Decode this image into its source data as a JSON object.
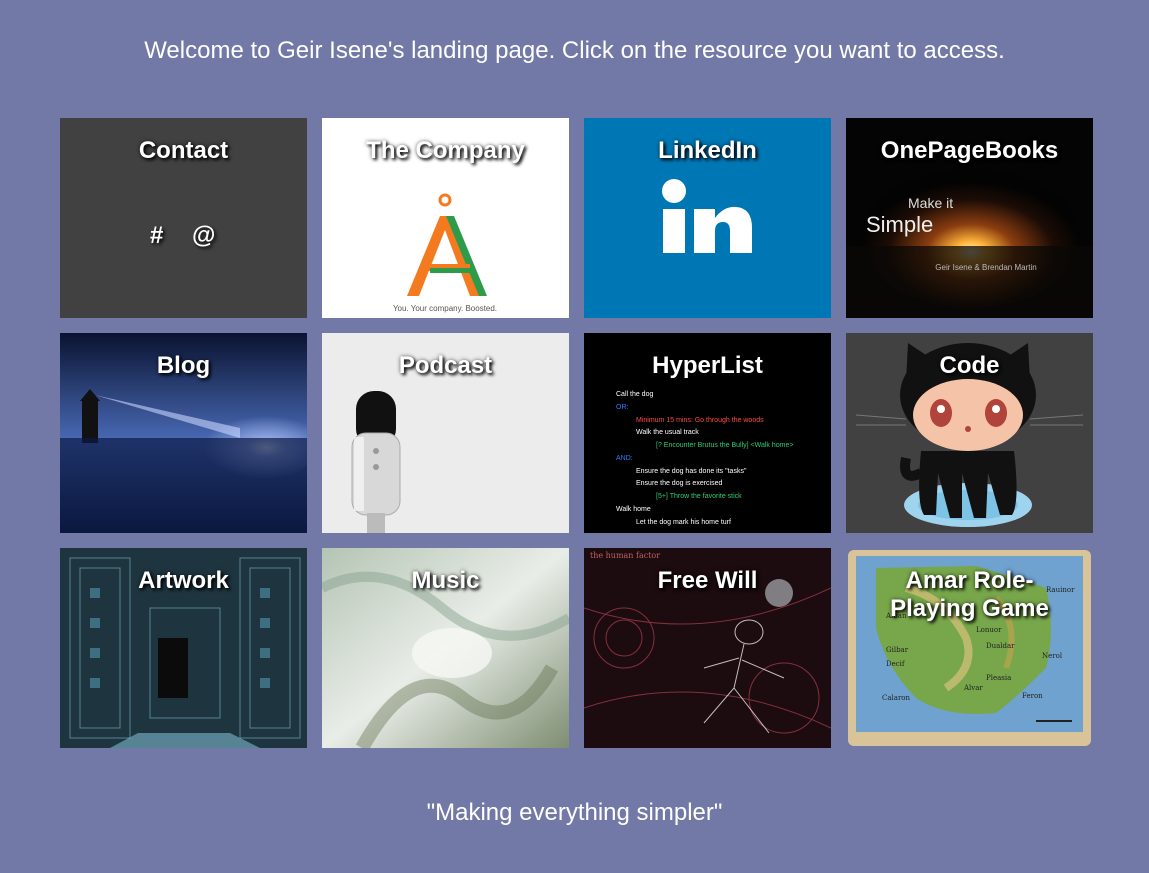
{
  "intro": "Welcome to Geir Isene's landing page. Click on the resource you want to access.",
  "tiles": [
    {
      "title": "Contact",
      "symbols": [
        "#",
        "@"
      ]
    },
    {
      "title": "The Company",
      "logo_letter": "Å",
      "tagline": "You. Your company. Boosted."
    },
    {
      "title": "LinkedIn",
      "logo": "in"
    },
    {
      "title": "OnePageBooks",
      "line1": "Make it",
      "line2": "Simple",
      "authors": "Geir Isene & Brendan Martin"
    },
    {
      "title": "Blog"
    },
    {
      "title": "Podcast"
    },
    {
      "title": "HyperList",
      "lines": [
        "Call the dog",
        "OR:",
        "Minimum 15 mins: Go through the woods",
        "Walk the usual track",
        "[? Encounter Brutus the Bully] <Walk home>",
        "AND:",
        "Ensure the dog has done its \"tasks\"",
        "Ensure the dog is exercised",
        "[5+] Throw the favorite stick",
        "Walk home",
        "Let the dog mark his home turf"
      ]
    },
    {
      "title": "Code"
    },
    {
      "title": "Artwork"
    },
    {
      "title": "Music"
    },
    {
      "title": "Free Will",
      "caption": "the human factor"
    },
    {
      "title_line1": "Amar Role-",
      "title_line2": "Playing Game",
      "places": [
        "Rauinor",
        "Alban",
        "Nerol",
        "Lonuor",
        "Gilbar",
        "Decif",
        "Dualdar",
        "Calaron",
        "Feron",
        "Alvar",
        "Pleasia"
      ]
    }
  ],
  "motto": "\"Making everything simpler\"",
  "colors": {
    "background": "#7279a6",
    "contact": "#414141",
    "linkedin": "#0077b5",
    "company_orange": "#f47a20",
    "company_green": "#2e9b4a"
  }
}
